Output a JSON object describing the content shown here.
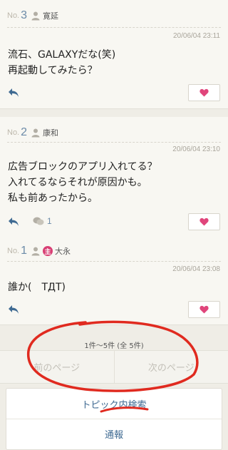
{
  "posts": [
    {
      "no_label": "No.",
      "number": "3",
      "author": "寛延",
      "timestamp": "20/06/04 23:11",
      "body": "流石、GALAXYだな(笑)\n再起動してみたら？"
    },
    {
      "no_label": "No.",
      "number": "2",
      "author": "康和",
      "timestamp": "20/06/04 23:10",
      "body": "広告ブロックのアプリ入れてる？\n入れてるならそれが原因かも。\n私も前あったから。",
      "comment_count": "1"
    },
    {
      "no_label": "No.",
      "number": "1",
      "owner_badge": "主",
      "author": "大永",
      "timestamp": "20/06/04 23:08",
      "body": "誰か(　TДT)"
    }
  ],
  "pager": {
    "info": "1件〜5件 (全 5件)",
    "prev_label": "前のページ",
    "next_label": "次のページ"
  },
  "menu": {
    "search_label": "トピック内検索",
    "report_label": "通報"
  },
  "colors": {
    "accent": "#6c8ba8",
    "like_heart": "#e0457b",
    "owner_badge": "#d83f74",
    "annotation_red": "#e02a1f"
  }
}
